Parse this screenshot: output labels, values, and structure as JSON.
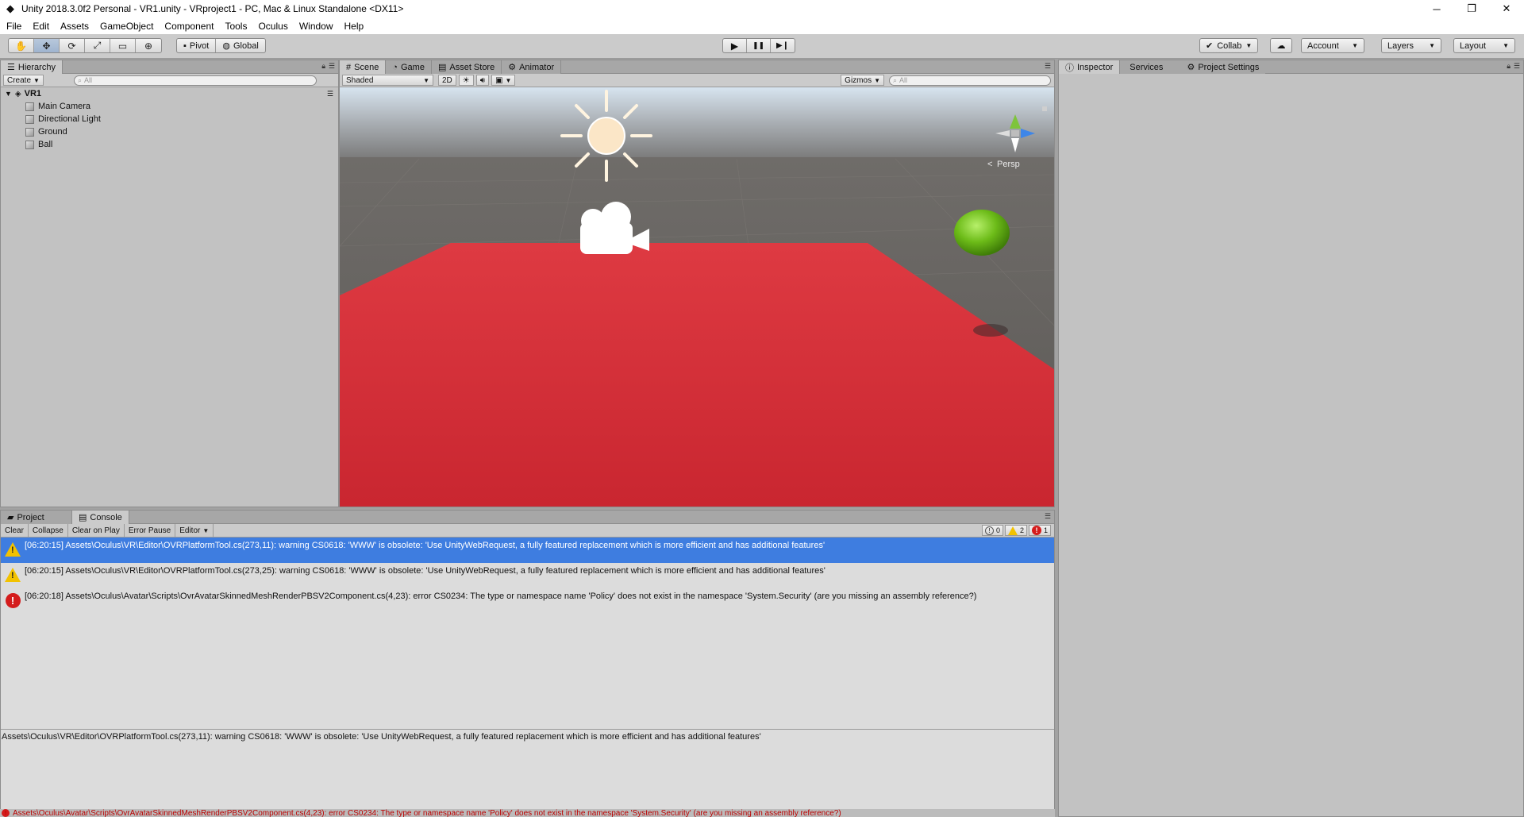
{
  "window": {
    "title": "Unity 2018.3.0f2 Personal - VR1.unity - VRproject1 - PC, Mac & Linux Standalone <DX11>",
    "minimize": "─",
    "restore": "❐",
    "close": "✕"
  },
  "menu": [
    "File",
    "Edit",
    "Assets",
    "GameObject",
    "Component",
    "Tools",
    "Oculus",
    "Window",
    "Help"
  ],
  "toolbar": {
    "tools": [
      "hand-icon",
      "move-icon",
      "rotate-icon",
      "scale-icon",
      "rect-icon",
      "transform-icon"
    ],
    "tool_glyphs": [
      "✋",
      "✥",
      "⟳",
      "⤢",
      "▭",
      "⊕"
    ],
    "pivot": "Pivot",
    "global": "Global",
    "play": "▶",
    "pause": "❚❚",
    "step": "▶❙",
    "collab": "Collab",
    "cloud": "☁",
    "account": "Account",
    "layers": "Layers",
    "layout": "Layout"
  },
  "hierarchy": {
    "tab": "Hierarchy",
    "create": "Create",
    "search_placeholder": "All",
    "scene": "VR1",
    "items": [
      "Main Camera",
      "Directional Light",
      "Ground",
      "Ball"
    ]
  },
  "scene_panel": {
    "tabs": [
      "Scene",
      "Game",
      "Asset Store",
      "Animator"
    ],
    "shading": "Shaded",
    "mode_2d": "2D",
    "gizmos": "Gizmos",
    "search_placeholder": "All",
    "persp_label": "Persp",
    "colors": {
      "ground": "#d6303a",
      "ball": "#6fc018",
      "sky_top": "#d7e4ef",
      "horizon": "#7a7a7a"
    }
  },
  "inspector": {
    "tabs": [
      "Inspector",
      "Services",
      "Project Settings"
    ]
  },
  "console": {
    "tabs": [
      "Project",
      "Console"
    ],
    "buttons": [
      "Clear",
      "Collapse",
      "Clear on Play",
      "Error Pause",
      "Editor"
    ],
    "counts": {
      "info": "0",
      "warnings": "2",
      "errors": "1"
    },
    "logs": [
      {
        "type": "warning",
        "text": "[06:20:15] Assets\\Oculus\\VR\\Editor\\OVRPlatformTool.cs(273,11): warning CS0618: 'WWW' is obsolete: 'Use UnityWebRequest, a fully featured replacement which is more efficient and has additional features'"
      },
      {
        "type": "warning",
        "text": "[06:20:15] Assets\\Oculus\\VR\\Editor\\OVRPlatformTool.cs(273,25): warning CS0618: 'WWW' is obsolete: 'Use UnityWebRequest, a fully featured replacement which is more efficient and has additional features'"
      },
      {
        "type": "error",
        "text": "[06:20:18] Assets\\Oculus\\Avatar\\Scripts\\OvrAvatarSkinnedMeshRenderPBSV2Component.cs(4,23): error CS0234: The type or namespace name 'Policy' does not exist in the namespace 'System.Security' (are you missing an assembly reference?)"
      }
    ],
    "detail": "Assets\\Oculus\\VR\\Editor\\OVRPlatformTool.cs(273,11): warning CS0618: 'WWW' is obsolete: 'Use UnityWebRequest, a fully featured replacement which is more efficient and has additional features'"
  },
  "status": {
    "text": "Assets\\Oculus\\Avatar\\Scripts\\OvrAvatarSkinnedMeshRenderPBSV2Component.cs(4,23): error CS0234: The type or namespace name 'Policy' does not exist in the namespace 'System.Security' (are you missing an assembly reference?)"
  }
}
